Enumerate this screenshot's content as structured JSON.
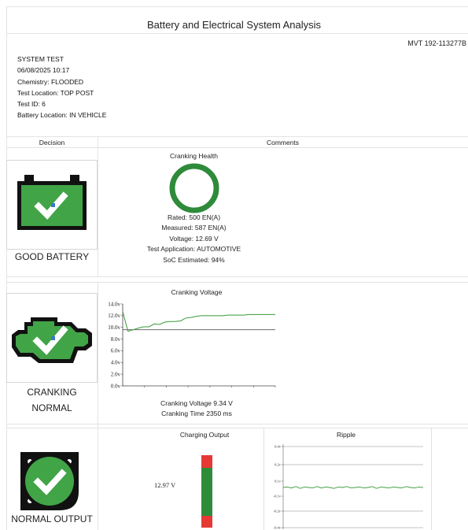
{
  "report": {
    "title": "Battery and Electrical System Analysis",
    "serial": "MVT  192-113277B"
  },
  "test_info": {
    "lines": [
      "SYSTEM TEST",
      "06/08/2025 10:17",
      "Chemistry: FLOODED",
      "Test Location: TOP POST",
      "Test ID: 6",
      "Battery Location: IN VEHICLE"
    ]
  },
  "columns": {
    "decision": "Decision",
    "comments": "Comments"
  },
  "battery": {
    "result": "GOOD BATTERY",
    "chart_title": "Cranking Health",
    "details": [
      "Rated: 500 EN(A)",
      "Measured: 587 EN(A)",
      "Voltage: 12.69 V",
      "Test Application: AUTOMOTIVE",
      "SoC Estimated: 94%"
    ],
    "icon": "battery-check-icon",
    "ring_color": "#2e8b3a",
    "health_fraction": 1.0
  },
  "cranking": {
    "result_line1": "CRANKING",
    "result_line2": "NORMAL",
    "icon": "engine-check-icon",
    "cranking_voltage": "Cranking Voltage 9.34 V",
    "cranking_time": "Cranking Time 2350 ms"
  },
  "charging": {
    "result": "NORMAL OUTPUT",
    "icon": "alternator-check-icon",
    "output_title": "Charging Output",
    "output_value": "12.97 V",
    "ripple_title": "Ripple"
  },
  "colors": {
    "green": "#41a447",
    "dark_green": "#2e8b3a",
    "red": "#e53935",
    "line_green": "#3a9a3a"
  },
  "chart_data": [
    {
      "type": "line",
      "title": "Cranking Voltage",
      "yticks": [
        "14.0v",
        "12.0v",
        "10.0v",
        "8.0v",
        "6.0v",
        "4.0v",
        "2.0v",
        "0.0v"
      ],
      "ylim": [
        0,
        14
      ],
      "reference_line": 9.6,
      "series": [
        {
          "values": [
            12.7,
            9.34,
            9.6,
            9.9,
            10.1,
            10.1,
            10.6,
            10.5,
            10.9,
            11.0,
            11.0,
            11.1,
            11.6,
            11.7,
            11.9,
            12.0,
            12.0,
            12.0,
            12.0,
            12.0,
            12.1,
            12.1,
            12.1,
            12.1,
            12.2,
            12.2,
            12.2,
            12.2,
            12.2,
            12.2
          ]
        }
      ]
    },
    {
      "type": "line",
      "title": "Ripple",
      "yticks": [
        "0.4v",
        "0.2v",
        "0.1v",
        "-0.1v",
        "-0.2v",
        "-0.4v"
      ],
      "series": [
        {
          "values": [
            0.0,
            0.01,
            -0.01,
            0.02,
            -0.02,
            0.01,
            0.0,
            -0.01,
            0.02,
            -0.01,
            0.01,
            0.0,
            -0.02,
            0.01,
            0.0,
            0.02,
            -0.01,
            0.0,
            0.01,
            -0.01,
            0.0,
            0.02,
            -0.02,
            0.01,
            0.0,
            -0.01,
            0.01,
            0.0,
            -0.01,
            0.02,
            0.0,
            -0.01,
            0.01,
            0.0
          ]
        }
      ]
    }
  ]
}
